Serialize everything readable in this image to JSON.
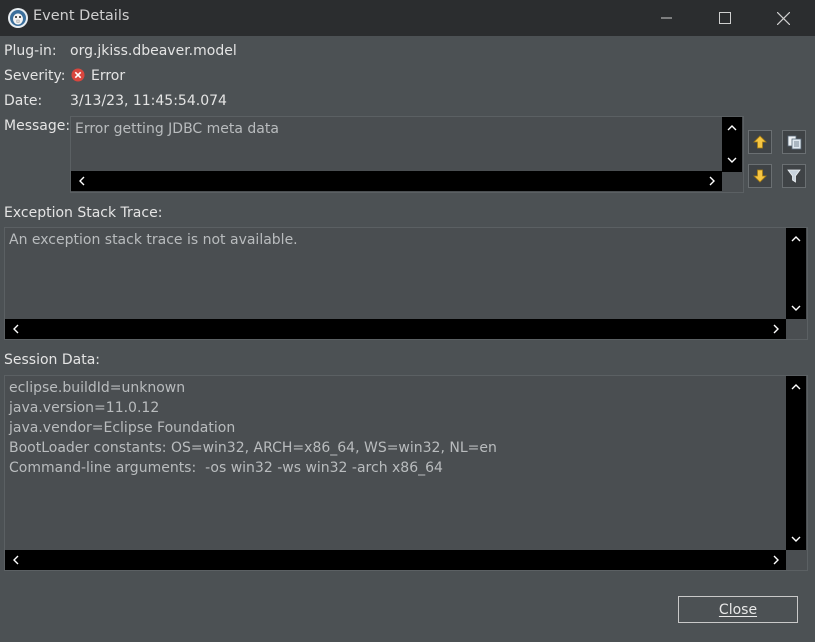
{
  "window": {
    "title": "Event Details",
    "icon": "dbeaver-beaver-icon",
    "controls": [
      "minimize-icon",
      "maximize-icon",
      "close-icon"
    ]
  },
  "fields": {
    "plugin_label": "Plug-in:",
    "plugin_value": "org.jkiss.dbeaver.model",
    "severity_label": "Severity:",
    "severity_value": "Error",
    "severity_icon": "error-icon",
    "date_label": "Date:",
    "date_value": "3/13/23, 11:45:54.074",
    "message_label": "Message:",
    "message_value": "Error getting JDBC meta data"
  },
  "side_buttons": {
    "previous": "up-arrow-icon",
    "copy": "copy-icon",
    "next": "down-arrow-icon",
    "filter": "filter-icon"
  },
  "stack_trace": {
    "label": "Exception Stack Trace:",
    "text": "An exception stack trace is not available."
  },
  "session": {
    "label": "Session Data:",
    "lines": [
      "eclipse.buildId=unknown",
      "java.version=11.0.12",
      "java.vendor=Eclipse Foundation",
      "BootLoader constants: OS=win32, ARCH=x86_64, WS=win32, NL=en",
      "Command-line arguments:  -os win32 -ws win32 -arch x86_64"
    ]
  },
  "footer": {
    "close_label": "Close"
  },
  "colors": {
    "background": "#4c5154",
    "titlebar": "#2b2d2f",
    "scrollbar_track": "#000000",
    "error_red": "#d9463e",
    "arrow_yellow": "#f5c542"
  }
}
